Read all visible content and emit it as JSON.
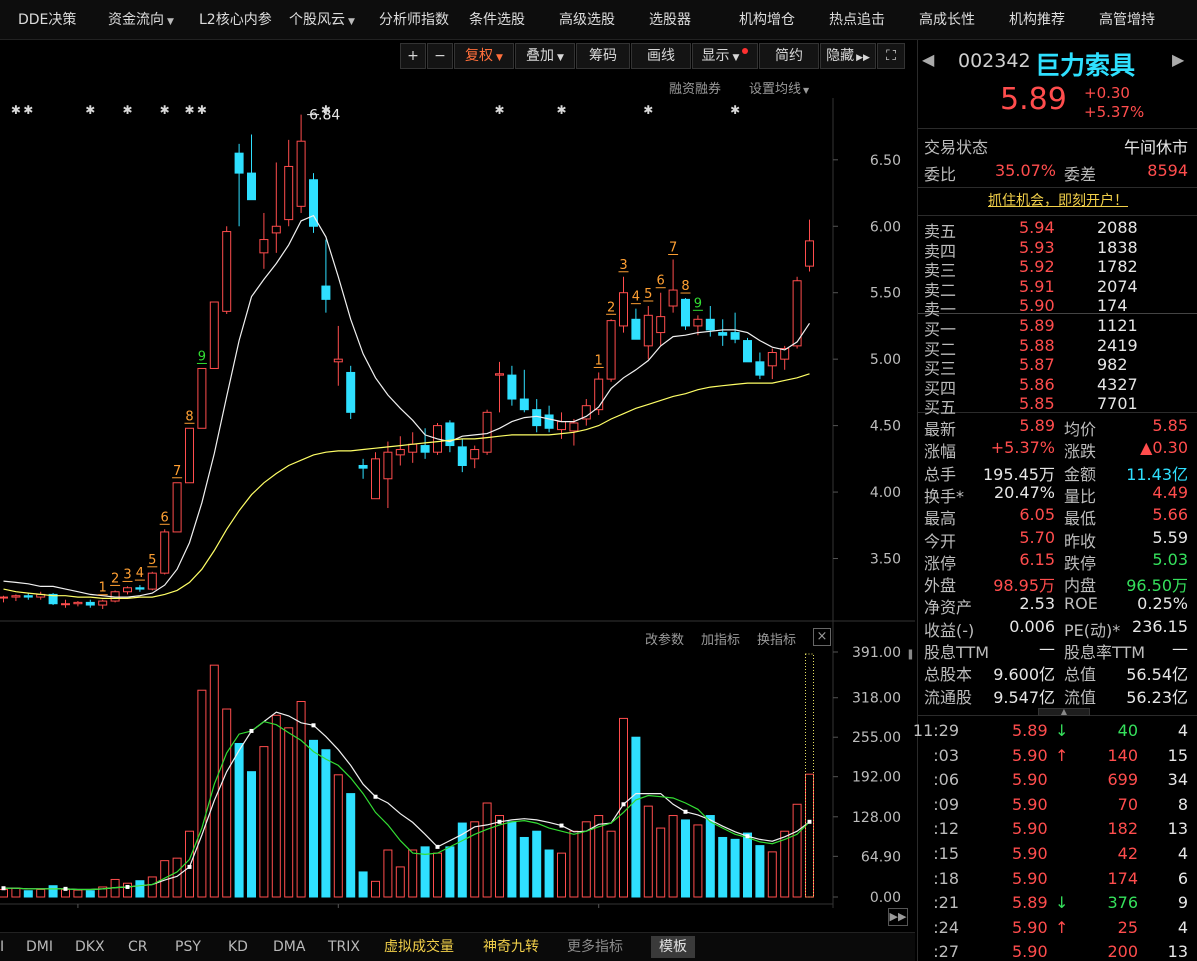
{
  "nav": {
    "items": [
      {
        "label": "DDE决策",
        "caret": false
      },
      {
        "label": "资金流向",
        "caret": true
      },
      {
        "label": "L2核心内参",
        "caret": false
      },
      {
        "label": "个股风云",
        "caret": true
      },
      {
        "label": "分析师指数",
        "caret": false
      },
      {
        "label": "条件选股",
        "caret": false
      },
      {
        "label": "高级选股",
        "caret": false
      },
      {
        "label": "选股器",
        "caret": false
      },
      {
        "label": "机构增仓",
        "caret": false
      },
      {
        "label": "热点追击",
        "caret": false
      },
      {
        "label": "高成长性",
        "caret": false
      },
      {
        "label": "机构推荐",
        "caret": false
      },
      {
        "label": "高管增持",
        "caret": false
      }
    ]
  },
  "toolbar": {
    "plus": "+",
    "minus": "−",
    "fuquan": "复权",
    "diejia": "叠加",
    "chouma": "筹码",
    "huaxian": "画线",
    "xianshi": "显示",
    "jianyue": "简约",
    "yincang": "隐藏",
    "expand": "⛶"
  },
  "chart_links": {
    "rongzi": "融资融券",
    "junxian": "设置均线"
  },
  "indicator_links": {
    "gaicanshu": "改参数",
    "jiazhibiao": "加指标",
    "huanzhibiao": "换指标",
    "close": "×"
  },
  "colors": {
    "up": "#ff4d4d",
    "down": "#2fe0ff",
    "ma_white": "#f0f0f0",
    "ma_yellow": "#ffff66",
    "vol_green": "#33dd33",
    "orange": "#ffa033"
  },
  "chart_data": {
    "type": "candlestick",
    "price_axis": {
      "ticks": [
        "3.50",
        "4.00",
        "4.50",
        "5.00",
        "5.50",
        "6.00",
        "6.50"
      ],
      "min": 3.06,
      "max": 6.95
    },
    "high_label": "6.84",
    "time_labels": [
      "03",
      "04",
      "05"
    ],
    "candles": [
      [
        3.21,
        3.22,
        3.17,
        3.21
      ],
      [
        3.21,
        3.23,
        3.18,
        3.22
      ],
      [
        3.22,
        3.24,
        3.19,
        3.21
      ],
      [
        3.21,
        3.25,
        3.19,
        3.23
      ],
      [
        3.23,
        3.24,
        3.15,
        3.16
      ],
      [
        3.16,
        3.19,
        3.13,
        3.16
      ],
      [
        3.16,
        3.18,
        3.14,
        3.17
      ],
      [
        3.17,
        3.19,
        3.13,
        3.15
      ],
      [
        3.15,
        3.19,
        3.12,
        3.18
      ],
      [
        3.18,
        3.26,
        3.17,
        3.25
      ],
      [
        3.25,
        3.29,
        3.23,
        3.28
      ],
      [
        3.28,
        3.3,
        3.25,
        3.27
      ],
      [
        3.27,
        3.4,
        3.26,
        3.39
      ],
      [
        3.39,
        3.72,
        3.38,
        3.7
      ],
      [
        3.7,
        4.07,
        3.7,
        4.07
      ],
      [
        4.07,
        4.48,
        4.07,
        4.48
      ],
      [
        4.48,
        4.93,
        4.48,
        4.93
      ],
      [
        4.93,
        5.43,
        4.93,
        5.43
      ],
      [
        5.36,
        6.0,
        5.34,
        5.96
      ],
      [
        6.55,
        6.62,
        6.0,
        6.4
      ],
      [
        6.4,
        6.69,
        6.35,
        6.2
      ],
      [
        5.8,
        6.1,
        5.68,
        5.9
      ],
      [
        5.95,
        6.48,
        5.8,
        6.0
      ],
      [
        6.05,
        6.65,
        6.0,
        6.45
      ],
      [
        6.15,
        6.84,
        6.1,
        6.64
      ],
      [
        6.35,
        6.4,
        5.95,
        6.0
      ],
      [
        5.55,
        5.9,
        5.35,
        5.45
      ],
      [
        4.98,
        5.25,
        4.8,
        5.0
      ],
      [
        4.9,
        4.95,
        4.55,
        4.6
      ],
      [
        4.2,
        4.25,
        4.1,
        4.18
      ],
      [
        3.95,
        4.3,
        3.95,
        4.25
      ],
      [
        4.1,
        4.38,
        3.88,
        4.3
      ],
      [
        4.28,
        4.42,
        4.2,
        4.32
      ],
      [
        4.3,
        4.45,
        4.22,
        4.36
      ],
      [
        4.35,
        4.48,
        4.25,
        4.3
      ],
      [
        4.3,
        4.52,
        4.28,
        4.5
      ],
      [
        4.52,
        4.54,
        4.3,
        4.35
      ],
      [
        4.34,
        4.4,
        4.15,
        4.2
      ],
      [
        4.25,
        4.35,
        4.18,
        4.32
      ],
      [
        4.3,
        4.62,
        4.28,
        4.6
      ],
      [
        4.88,
        4.98,
        4.6,
        4.89
      ],
      [
        4.88,
        4.95,
        4.65,
        4.7
      ],
      [
        4.7,
        4.92,
        4.6,
        4.62
      ],
      [
        4.62,
        4.7,
        4.45,
        4.5
      ],
      [
        4.58,
        4.65,
        4.45,
        4.48
      ],
      [
        4.47,
        4.6,
        4.4,
        4.53
      ],
      [
        4.46,
        4.55,
        4.35,
        4.52
      ],
      [
        4.55,
        4.7,
        4.5,
        4.65
      ],
      [
        4.62,
        4.9,
        4.58,
        4.85
      ],
      [
        4.85,
        5.3,
        4.83,
        5.29
      ],
      [
        5.25,
        5.62,
        5.2,
        5.5
      ],
      [
        5.3,
        5.38,
        5.15,
        5.15
      ],
      [
        5.1,
        5.4,
        5.0,
        5.33
      ],
      [
        5.2,
        5.5,
        5.1,
        5.32
      ],
      [
        5.4,
        5.75,
        5.35,
        5.52
      ],
      [
        5.45,
        5.46,
        5.22,
        5.25
      ],
      [
        5.25,
        5.33,
        5.18,
        5.3
      ],
      [
        5.3,
        5.4,
        5.17,
        5.22
      ],
      [
        5.2,
        5.3,
        5.1,
        5.18
      ],
      [
        5.2,
        5.35,
        5.12,
        5.15
      ],
      [
        5.14,
        5.16,
        4.98,
        4.98
      ],
      [
        4.98,
        5.05,
        4.85,
        4.88
      ],
      [
        4.95,
        5.08,
        4.85,
        5.05
      ],
      [
        5.0,
        5.1,
        4.92,
        5.08
      ],
      [
        5.1,
        5.62,
        5.08,
        5.59
      ],
      [
        5.7,
        6.05,
        5.66,
        5.89
      ]
    ],
    "ma_white": [
      3.33,
      3.32,
      3.31,
      3.29,
      3.29,
      3.27,
      3.25,
      3.23,
      3.22,
      3.21,
      3.21,
      3.22,
      3.24,
      3.3,
      3.42,
      3.62,
      3.92,
      4.29,
      4.72,
      5.14,
      5.47,
      5.6,
      5.72,
      5.86,
      6.04,
      6.08,
      5.92,
      5.62,
      5.3,
      5.04,
      4.86,
      4.73,
      4.63,
      4.54,
      4.43,
      4.4,
      4.38,
      4.42,
      4.43,
      4.44,
      4.48,
      4.53,
      4.56,
      4.57,
      4.55,
      4.53,
      4.53,
      4.57,
      4.64,
      4.78,
      4.86,
      4.92,
      4.99,
      5.1,
      5.17,
      5.18,
      5.2,
      5.21,
      5.22,
      5.22,
      5.2,
      5.14,
      5.09,
      5.07,
      5.13,
      5.27
    ],
    "ma_yellow": [
      3.27,
      3.25,
      3.24,
      3.23,
      3.22,
      3.22,
      3.21,
      3.21,
      3.2,
      3.2,
      3.2,
      3.21,
      3.21,
      3.23,
      3.26,
      3.32,
      3.42,
      3.56,
      3.72,
      3.86,
      3.98,
      4.07,
      4.14,
      4.2,
      4.24,
      4.28,
      4.3,
      4.31,
      4.31,
      4.32,
      4.33,
      4.34,
      4.35,
      4.36,
      4.37,
      4.38,
      4.39,
      4.4,
      4.4,
      4.41,
      4.42,
      4.43,
      4.43,
      4.43,
      4.43,
      4.44,
      4.45,
      4.47,
      4.5,
      4.55,
      4.59,
      4.63,
      4.66,
      4.69,
      4.72,
      4.74,
      4.77,
      4.79,
      4.8,
      4.81,
      4.82,
      4.82,
      4.82,
      4.84,
      4.86,
      4.89
    ],
    "td_counts": [
      {
        "i": 8,
        "label": "1",
        "color": "#ffa033"
      },
      {
        "i": 9,
        "label": "2",
        "color": "#ffa033"
      },
      {
        "i": 10,
        "label": "3",
        "color": "#ffa033"
      },
      {
        "i": 11,
        "label": "4",
        "color": "#ffa033"
      },
      {
        "i": 12,
        "label": "5",
        "color": "#ffa033"
      },
      {
        "i": 13,
        "label": "6",
        "color": "#ffa033"
      },
      {
        "i": 14,
        "label": "7",
        "color": "#ffa033"
      },
      {
        "i": 15,
        "label": "8",
        "color": "#ffa033"
      },
      {
        "i": 16,
        "label": "9",
        "color": "#33dd33"
      },
      {
        "i": 48,
        "label": "1",
        "color": "#ffa033"
      },
      {
        "i": 49,
        "label": "2",
        "color": "#ffa033"
      },
      {
        "i": 50,
        "label": "3",
        "color": "#ffa033"
      },
      {
        "i": 51,
        "label": "4",
        "color": "#ffa033"
      },
      {
        "i": 52,
        "label": "5",
        "color": "#ffa033"
      },
      {
        "i": 53,
        "label": "6",
        "color": "#ffa033"
      },
      {
        "i": 54,
        "label": "7",
        "color": "#ffa033"
      },
      {
        "i": 55,
        "label": "8",
        "color": "#ffa033"
      },
      {
        "i": 56,
        "label": "9",
        "color": "#33dd33"
      }
    ],
    "markers": [
      1,
      2,
      7,
      10,
      13,
      15,
      16,
      26,
      40,
      45,
      52,
      59
    ],
    "volume_axis": {
      "ticks": [
        "0.00",
        "64.90",
        "128.00",
        "192.00",
        "255.00",
        "318.00",
        "391.00"
      ],
      "max": 391
    },
    "volumes": [
      12,
      14,
      10,
      12,
      18,
      12,
      11,
      10,
      16,
      28,
      22,
      26,
      32,
      58,
      62,
      105,
      330,
      370,
      300,
      245,
      200,
      240,
      290,
      270,
      312,
      250,
      235,
      195,
      165,
      40,
      25,
      75,
      48,
      75,
      80,
      70,
      80,
      118,
      120,
      150,
      130,
      120,
      95,
      105,
      75,
      70,
      105,
      120,
      130,
      105,
      285,
      255,
      145,
      110,
      130,
      123,
      115,
      130,
      95,
      92,
      102,
      82,
      72,
      105,
      148,
      196
    ],
    "vol_ma_white": [
      14,
      14,
      13,
      13,
      13,
      13,
      12,
      12,
      13,
      15,
      16,
      18,
      20,
      27,
      33,
      48,
      99,
      154,
      200,
      234,
      265,
      280,
      295,
      289,
      278,
      274,
      256,
      235,
      210,
      180,
      160,
      150,
      133,
      119,
      100,
      80,
      90,
      100,
      112,
      115,
      120,
      123,
      125,
      123,
      119,
      114,
      104,
      105,
      116,
      118,
      148,
      165,
      165,
      165,
      148,
      136,
      131,
      123,
      113,
      104,
      97,
      92,
      89,
      96,
      105,
      120
    ],
    "vol_ma_green": [
      14,
      14,
      13,
      13,
      13,
      13,
      12,
      12,
      13,
      15,
      16,
      18,
      20,
      30,
      40,
      60,
      110,
      180,
      230,
      260,
      265,
      280,
      275,
      262,
      250,
      232,
      220,
      210,
      190,
      165,
      135,
      115,
      90,
      70,
      68,
      70,
      80,
      90,
      100,
      108,
      115,
      120,
      122,
      118,
      110,
      105,
      100,
      105,
      112,
      118,
      135,
      155,
      162,
      160,
      158,
      150,
      140,
      120,
      110,
      100,
      95,
      88,
      85,
      92,
      100,
      120
    ]
  },
  "quote": {
    "code": "002342",
    "name": "巨力索具",
    "price": "5.89",
    "change": "+0.30",
    "change_pct": "+5.37%",
    "trade_status_label": "交易状态",
    "trade_status": "午间休市",
    "weibi_label": "委比",
    "weibi": "35.07%",
    "weicha_label": "委差",
    "weicha": "8594",
    "promo": "抓住机会，即刻开户！",
    "asks": [
      {
        "label": "卖五",
        "price": "5.94",
        "vol": "2088"
      },
      {
        "label": "卖四",
        "price": "5.93",
        "vol": "1838"
      },
      {
        "label": "卖三",
        "price": "5.92",
        "vol": "1782"
      },
      {
        "label": "卖二",
        "price": "5.91",
        "vol": "2074"
      },
      {
        "label": "卖一",
        "price": "5.90",
        "vol": "174"
      }
    ],
    "bids": [
      {
        "label": "买一",
        "price": "5.89",
        "vol": "1121"
      },
      {
        "label": "买二",
        "price": "5.88",
        "vol": "2419"
      },
      {
        "label": "买三",
        "price": "5.87",
        "vol": "982"
      },
      {
        "label": "买四",
        "price": "5.86",
        "vol": "4327"
      },
      {
        "label": "买五",
        "price": "5.85",
        "vol": "7701"
      }
    ],
    "stats": [
      {
        "l1": "最新",
        "v1": "5.89",
        "c1": "red",
        "l2": "均价",
        "v2": "5.85",
        "c2": "red"
      },
      {
        "l1": "涨幅",
        "v1": "+5.37%",
        "c1": "red",
        "l2": "涨跌",
        "v2": "▲0.30",
        "c2": "red"
      },
      {
        "l1": "总手",
        "v1": "195.45万",
        "c1": "white",
        "l2": "金额",
        "v2": "11.43亿",
        "c2": "cyan"
      },
      {
        "l1": "换手*",
        "v1": "20.47%",
        "c1": "white",
        "l2": "量比",
        "v2": "4.49",
        "c2": "red"
      },
      {
        "l1": "最高",
        "v1": "6.05",
        "c1": "red",
        "l2": "最低",
        "v2": "5.66",
        "c2": "red"
      },
      {
        "l1": "今开",
        "v1": "5.70",
        "c1": "red",
        "l2": "昨收",
        "v2": "5.59",
        "c2": "white"
      },
      {
        "l1": "涨停",
        "v1": "6.15",
        "c1": "red",
        "l2": "跌停",
        "v2": "5.03",
        "c2": "green"
      },
      {
        "l1": "外盘",
        "v1": "98.95万",
        "c1": "red",
        "l2": "内盘",
        "v2": "96.50万",
        "c2": "green"
      },
      {
        "l1": "净资产",
        "v1": "2.53",
        "c1": "white",
        "l2": "ROE",
        "v2": "0.25%",
        "c2": "white"
      },
      {
        "l1": "收益(-)",
        "v1": "0.006",
        "c1": "white",
        "l2": "PE(动)*",
        "v2": "236.15",
        "c2": "white"
      },
      {
        "l1": "股息TTM",
        "v1": "—",
        "c1": "white",
        "l2": "股息率TTM",
        "v2": "—",
        "c2": "white"
      },
      {
        "l1": "总股本",
        "v1": "9.600亿",
        "c1": "white",
        "l2": "总值",
        "v2": "56.54亿",
        "c2": "white"
      },
      {
        "l1": "流通股",
        "v1": "9.547亿",
        "c1": "white",
        "l2": "流值",
        "v2": "56.23亿",
        "c2": "white"
      }
    ],
    "ticks": [
      {
        "time": "11:29",
        "price": "5.89",
        "dir": "down",
        "vol": "40",
        "vol_color": "green",
        "n": "4"
      },
      {
        "time": ":03",
        "price": "5.90",
        "dir": "up",
        "vol": "140",
        "vol_color": "red",
        "n": "15"
      },
      {
        "time": ":06",
        "price": "5.90",
        "dir": "",
        "vol": "699",
        "vol_color": "red",
        "n": "34"
      },
      {
        "time": ":09",
        "price": "5.90",
        "dir": "",
        "vol": "70",
        "vol_color": "red",
        "n": "8"
      },
      {
        "time": ":12",
        "price": "5.90",
        "dir": "",
        "vol": "182",
        "vol_color": "red",
        "n": "13"
      },
      {
        "time": ":15",
        "price": "5.90",
        "dir": "",
        "vol": "42",
        "vol_color": "red",
        "n": "4"
      },
      {
        "time": ":18",
        "price": "5.90",
        "dir": "",
        "vol": "174",
        "vol_color": "red",
        "n": "6"
      },
      {
        "time": ":21",
        "price": "5.89",
        "dir": "down",
        "vol": "376",
        "vol_color": "green",
        "n": "9"
      },
      {
        "time": ":24",
        "price": "5.90",
        "dir": "up",
        "vol": "25",
        "vol_color": "red",
        "n": "4"
      },
      {
        "time": ":27",
        "price": "5.90",
        "dir": "",
        "vol": "200",
        "vol_color": "red",
        "n": "13"
      }
    ]
  },
  "bottom_tabs": [
    {
      "label": "I",
      "style": ""
    },
    {
      "label": "DMI",
      "style": ""
    },
    {
      "label": "DKX",
      "style": ""
    },
    {
      "label": "CR",
      "style": ""
    },
    {
      "label": "PSY",
      "style": ""
    },
    {
      "label": "KD",
      "style": ""
    },
    {
      "label": "DMA",
      "style": ""
    },
    {
      "label": "TRIX",
      "style": ""
    },
    {
      "label": "虚拟成交量",
      "style": "yellow"
    },
    {
      "label": "神奇九转",
      "style": "yellow"
    },
    {
      "label": "更多指标",
      "style": "gray"
    },
    {
      "label": "模板",
      "style": "active"
    }
  ]
}
